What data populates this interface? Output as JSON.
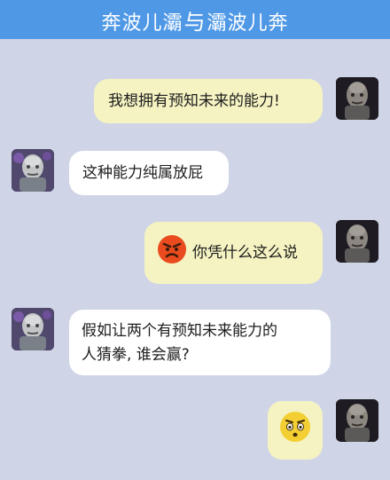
{
  "header": {
    "title_left": "奔波儿灞",
    "title_sep": "与",
    "title_right": "灞波儿奔"
  },
  "messages": [
    {
      "sender": "right",
      "text": "我想拥有预知未来的能力!"
    },
    {
      "sender": "left",
      "text": "这种能力纯属放屁"
    },
    {
      "sender": "right",
      "text": "你凭什么这么说",
      "icon": "angry-face-icon"
    },
    {
      "sender": "left",
      "text_line1": "假如让两个有预知未来能力的",
      "text_line2": "人猜拳, 谁会赢?"
    },
    {
      "sender": "right",
      "text": "",
      "icon": "suspicious-face-icon"
    }
  ]
}
